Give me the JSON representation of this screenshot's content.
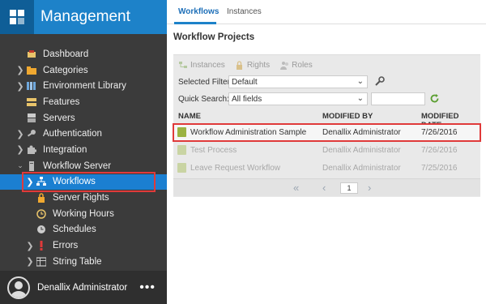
{
  "app": {
    "title": "Management"
  },
  "sidebar": {
    "items": [
      {
        "label": "Dashboard",
        "icon": "dashboard-icon",
        "expandable": false,
        "level": 0
      },
      {
        "label": "Categories",
        "icon": "folder-icon",
        "expandable": true,
        "level": 0
      },
      {
        "label": "Environment Library",
        "icon": "library-icon",
        "expandable": true,
        "level": 0
      },
      {
        "label": "Features",
        "icon": "features-icon",
        "expandable": false,
        "level": 0
      },
      {
        "label": "Servers",
        "icon": "servers-icon",
        "expandable": false,
        "level": 0
      },
      {
        "label": "Authentication",
        "icon": "key-icon",
        "expandable": true,
        "level": 0
      },
      {
        "label": "Integration",
        "icon": "puzzle-icon",
        "expandable": true,
        "level": 0
      },
      {
        "label": "Workflow Server",
        "icon": "server-icon",
        "expandable": true,
        "expanded": true,
        "level": 0
      },
      {
        "label": "Workflows",
        "icon": "workflow-icon",
        "expandable": true,
        "level": 1,
        "selected": true
      },
      {
        "label": "Server Rights",
        "icon": "lock-icon",
        "expandable": false,
        "level": 1
      },
      {
        "label": "Working Hours",
        "icon": "clock-icon",
        "expandable": false,
        "level": 1
      },
      {
        "label": "Schedules",
        "icon": "schedule-icon",
        "expandable": false,
        "level": 1
      },
      {
        "label": "Errors",
        "icon": "error-icon",
        "expandable": true,
        "level": 1
      },
      {
        "label": "String Table",
        "icon": "table-icon",
        "expandable": true,
        "level": 1
      }
    ]
  },
  "user": {
    "name": "Denallix Administrator",
    "more": "•••"
  },
  "tabs": [
    {
      "label": "Workflows",
      "active": true
    },
    {
      "label": "Instances",
      "active": false
    }
  ],
  "main": {
    "title": "Workflow Projects",
    "toolbar": [
      {
        "label": "Instances",
        "icon": "instances-icon"
      },
      {
        "label": "Rights",
        "icon": "lock-icon"
      },
      {
        "label": "Roles",
        "icon": "roles-icon"
      }
    ],
    "filter": {
      "label": "Selected Filter:",
      "value": "Default"
    },
    "quick_search": {
      "label": "Quick Search:",
      "field": "All fields",
      "value": ""
    },
    "columns": [
      "NAME",
      "MODIFIED BY",
      "MODIFIED DATE"
    ],
    "rows": [
      {
        "name": "Workflow Administration Sample",
        "modified_by": "Denallix Administrator",
        "modified_date": "7/26/2016",
        "active": true
      },
      {
        "name": "Test Process",
        "modified_by": "Denallix Administrator",
        "modified_date": "7/26/2016",
        "active": false
      },
      {
        "name": "Leave Request Workflow",
        "modified_by": "Denallix Administrator",
        "modified_date": "7/25/2016",
        "active": false
      }
    ],
    "pager": {
      "page": "1"
    }
  },
  "colors": {
    "accent": "#1d82c9",
    "sidebar_bg": "#3b3b3b",
    "highlight_outline": "#e03a3a"
  }
}
